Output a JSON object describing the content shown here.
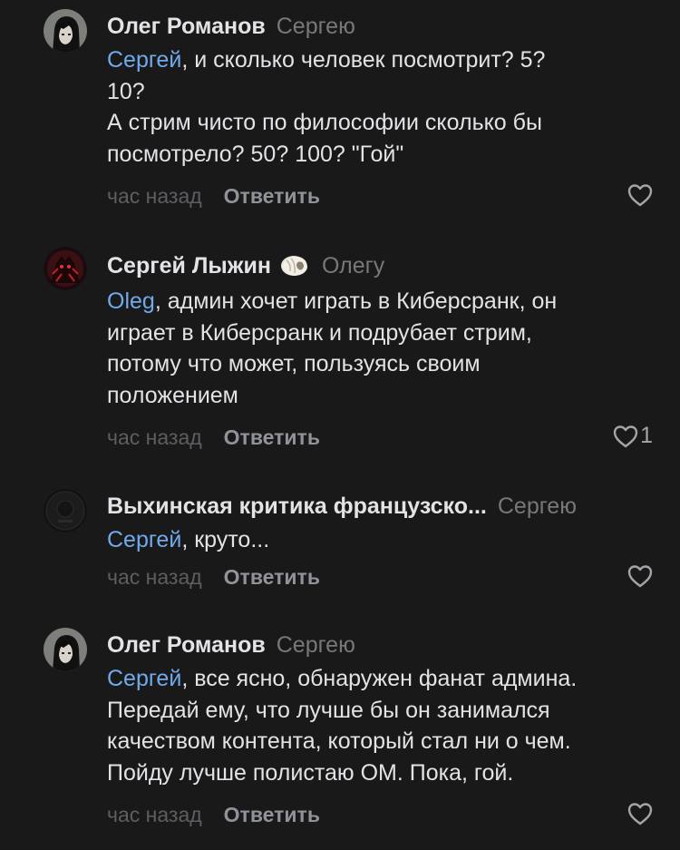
{
  "comments": [
    {
      "author": "Олег Романов",
      "reply_to": "Сергею",
      "mention": "Сергей",
      "lines_first_rest": ", и сколько человек посмотрит? 5?",
      "lines": [
        "10?",
        "А стрим чисто по философии сколько бы",
        "посмотрело? 50? 100? \"Гой\""
      ],
      "time": "час назад",
      "reply_label": "Ответить",
      "likes": "",
      "avatar_icon": "anime-character-avatar-icon",
      "like_icon": "heart-outline-icon"
    },
    {
      "author": "Сергей Лыжин",
      "badge_icon": "seashell-icon",
      "reply_to": "Олегу",
      "mention": "Oleg",
      "lines_first_rest": ", админ хочет играть в Киберсранк, он",
      "lines": [
        "играет в Киберсранк и подрубает стрим,",
        "потому что может, пользуясь своим",
        "положением"
      ],
      "time": "час назад",
      "reply_label": "Ответить",
      "likes": "1",
      "avatar_icon": "dark-red-creature-avatar-icon",
      "like_icon": "heart-outline-icon"
    },
    {
      "author": "Выхинская критика французско...",
      "reply_to": "Сергею",
      "mention": "Сергей",
      "lines_first_rest": ", круто...",
      "lines": [],
      "time": "час назад",
      "reply_label": "Ответить",
      "likes": "",
      "avatar_icon": "dark-community-avatar-icon",
      "like_icon": "heart-outline-icon"
    },
    {
      "author": "Олег Романов",
      "reply_to": "Сергею",
      "mention": "Сергей",
      "lines_first_rest": ", все ясно, обнаружен фанат админа.",
      "lines": [
        "Передай ему, что лучше бы он занимался",
        "качеством контента, который стал ни о чем.",
        "Пойду лучше полистаю ОМ. Пока, гой."
      ],
      "time": "час назад",
      "reply_label": "Ответить",
      "likes": "",
      "avatar_icon": "anime-character-avatar-icon",
      "like_icon": "heart-outline-icon"
    }
  ],
  "colors": {
    "background": "#19191a",
    "text": "#e2e3e6",
    "mention": "#71aaeb",
    "secondary": "#76787a"
  }
}
